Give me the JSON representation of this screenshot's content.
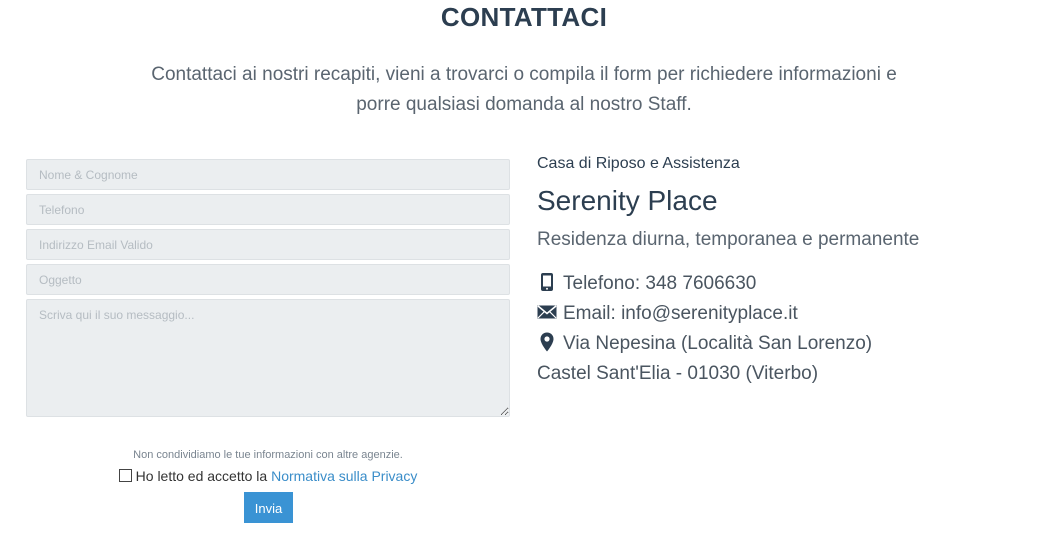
{
  "header": {
    "title": "CONTATTACI",
    "intro_line1": "Contattaci ai nostri recapiti, vieni a trovarci o compila il form per richiedere informazioni e",
    "intro_line2": "porre qualsiasi domanda al nostro Staff."
  },
  "form": {
    "name_placeholder": "Nome & Cognome",
    "phone_placeholder": "Telefono",
    "email_placeholder": "Indirizzo Email Valido",
    "subject_placeholder": "Oggetto",
    "message_placeholder": "Scriva qui il suo messaggio...",
    "privacy_note": "Non condividiamo le tue informazioni con altre agenzie.",
    "consent_text": "Ho letto ed accetto la",
    "privacy_link": "Normativa sulla Privacy",
    "submit_label": "Invia"
  },
  "info": {
    "subtitle": "Casa di Riposo e Assistenza",
    "name": "Serenity Place",
    "tagline": "Residenza diurna, temporanea e permanente",
    "phone": "Telefono: 348 7606630",
    "email": "Email: info@serenityplace.it",
    "address_line1": "Via Nepesina (Località San Lorenzo)",
    "address_line2": "Castel Sant'Elia - 01030 (Viterbo)",
    "icons": {
      "phone": "mobile-phone-icon",
      "email": "envelope-icon",
      "address": "map-marker-icon"
    }
  },
  "colors": {
    "heading": "#2c3e50",
    "accent": "#3a93d4",
    "link": "#3a8dc9",
    "field_bg": "#ebeef0"
  }
}
